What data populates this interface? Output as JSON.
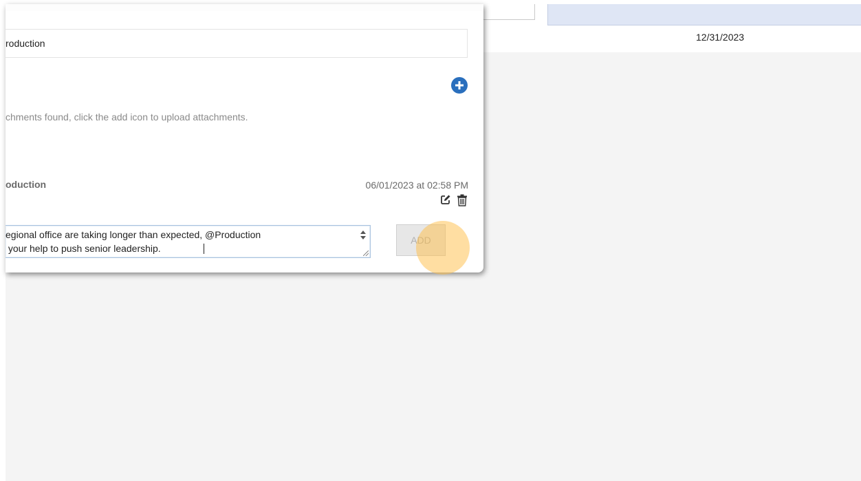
{
  "background": {
    "date_cell": "12/31/2023"
  },
  "modal": {
    "assignee_value": "roduction",
    "attachments": {
      "add_icon": "plus-circle-icon",
      "empty_message": "chments found, click the add icon to upload attachments."
    },
    "comment": {
      "author": "oduction",
      "timestamp": "06/01/2023 at 02:58 PM",
      "edit_icon": "edit-icon",
      "delete_icon": "trash-icon"
    },
    "new_comment": {
      "value": "egional office are taking longer than expected, @Production\n your help to push senior leadership."
    },
    "add_button_label": "ADD"
  },
  "colors": {
    "accent": "#2a6fbd",
    "click_highlight": "#ffbe46",
    "header_fill": "#dfe6f5"
  }
}
